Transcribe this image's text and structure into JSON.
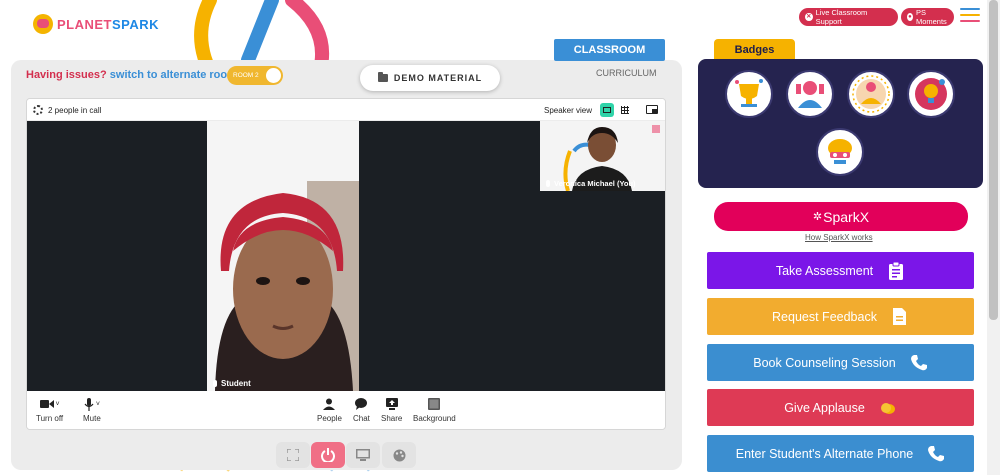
{
  "header": {
    "logo_text_1": "PLANET",
    "logo_text_2": "SPARK",
    "live_support_label": "Live Classroom Support",
    "ps_moments_label": "PS Moments"
  },
  "tabs": {
    "classroom": "CLASSROOM",
    "curriculum": "CURRICULUM",
    "badges": "Badges"
  },
  "issue_bar": {
    "having_issues": "Having issues?",
    "switch_text": "switch to alternate room",
    "room_toggle": "ROOM 2"
  },
  "demo_material_label": "DEMO MATERIAL",
  "video": {
    "people_in_call": "2 people in call",
    "speaker_view_label": "Speaker view",
    "student_name": "Student",
    "teacher_name": "Veronica Michael (You)"
  },
  "toolbar": {
    "turn_off": "Turn off",
    "mute": "Mute",
    "people": "People",
    "chat": "Chat",
    "share": "Share",
    "background": "Background"
  },
  "right_panel": {
    "sparkx_label": "SparkX",
    "how_sparkx": "How SparkX works",
    "actions": [
      {
        "label": "Take Assessment",
        "color": "#7b16e8",
        "icon": "clipboard-icon"
      },
      {
        "label": "Request Feedback",
        "color": "#f2ac2f",
        "icon": "document-icon"
      },
      {
        "label": "Book Counseling Session",
        "color": "#3b8ed0",
        "icon": "phone-icon"
      },
      {
        "label": "Give Applause",
        "color": "#de3a55",
        "icon": "clap-icon"
      },
      {
        "label": "Enter Student's Alternate Phone",
        "color": "#3b8ed0",
        "icon": "phone-icon"
      }
    ]
  },
  "colors": {
    "brand_red": "#d32f4e",
    "brand_blue": "#3a8fd6",
    "badge_panel": "#25234f",
    "sparkx": "#e2005a"
  }
}
